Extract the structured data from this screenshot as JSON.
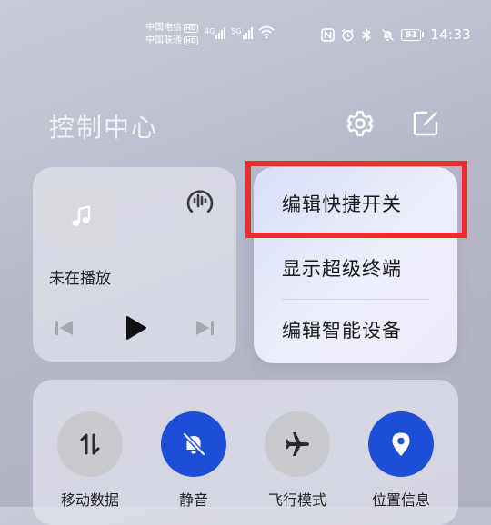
{
  "status_bar": {
    "carrier_1": "中国电信",
    "carrier_2": "中国联通",
    "hd_badge": "HD",
    "net_1": "4G",
    "net_2": "5G",
    "battery_level": "81",
    "time": "14:33"
  },
  "header": {
    "title": "控制中心"
  },
  "media": {
    "status_text": "未在播放"
  },
  "menu": {
    "items": [
      {
        "label": "编辑快捷开关"
      },
      {
        "label": "显示超级终端"
      },
      {
        "label": "编辑智能设备"
      }
    ]
  },
  "toggles": [
    {
      "label": "移动数据",
      "state": "off"
    },
    {
      "label": "静音",
      "state": "on"
    },
    {
      "label": "飞行模式",
      "state": "off"
    },
    {
      "label": "位置信息",
      "state": "on"
    }
  ],
  "colors": {
    "accent": "#1d4fd6",
    "highlight": "#e8302e"
  }
}
